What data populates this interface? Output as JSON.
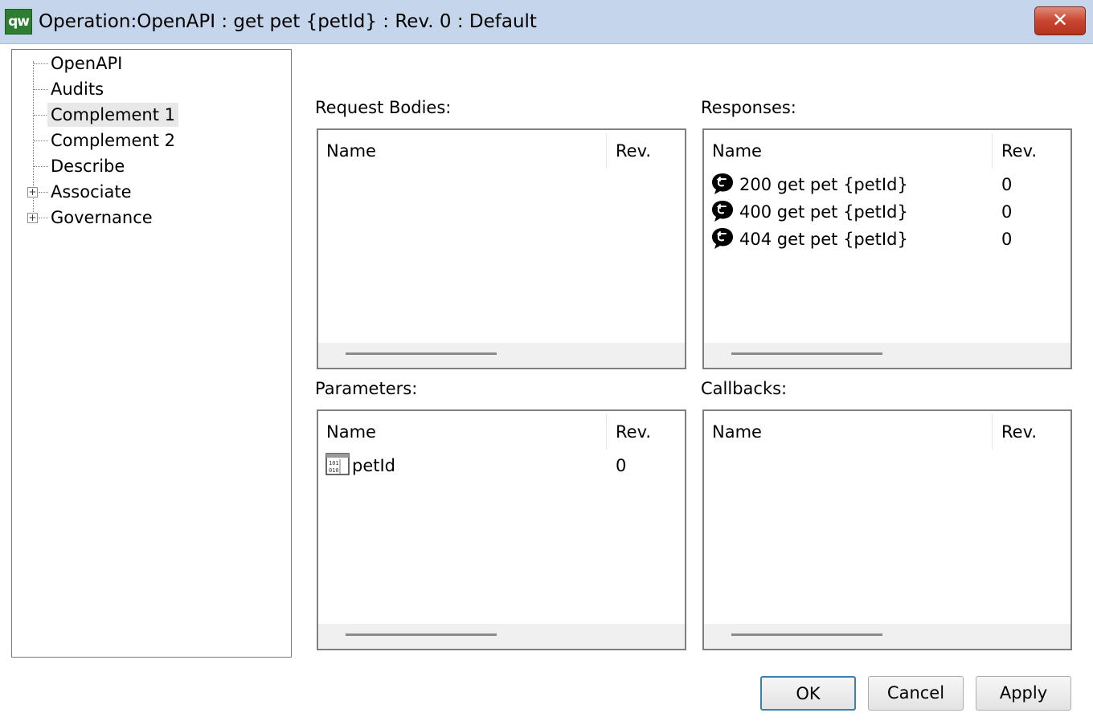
{
  "window": {
    "app_icon_text": "qw",
    "title": "Operation:OpenAPI : get pet {petId} : Rev. 0  : Default",
    "close_glyph": "✕"
  },
  "tree": {
    "items": [
      {
        "label": "OpenAPI",
        "expandable": false,
        "selected": false
      },
      {
        "label": "Audits",
        "expandable": false,
        "selected": false
      },
      {
        "label": "Complement 1",
        "expandable": false,
        "selected": true
      },
      {
        "label": "Complement 2",
        "expandable": false,
        "selected": false
      },
      {
        "label": "Describe",
        "expandable": false,
        "selected": false
      },
      {
        "label": "Associate",
        "expandable": true,
        "selected": false
      },
      {
        "label": "Governance",
        "expandable": true,
        "selected": false
      }
    ],
    "expander_glyph": "+"
  },
  "request_bodies": {
    "label": "Request Bodies:",
    "col_name": "Name",
    "col_rev": "Rev.",
    "rows": []
  },
  "responses": {
    "label": "Responses:",
    "col_name": "Name",
    "col_rev": "Rev.",
    "row_icon": "response-speech-icon",
    "rows": [
      {
        "name": "200 get pet {petId}",
        "rev": "0"
      },
      {
        "name": "400 get pet {petId}",
        "rev": "0"
      },
      {
        "name": "404 get pet {petId}",
        "rev": "0"
      }
    ]
  },
  "parameters": {
    "label": "Parameters:",
    "col_name": "Name",
    "col_rev": "Rev.",
    "row_icon": "binary-parameter-icon",
    "rows": [
      {
        "name": "petId",
        "rev": "0"
      }
    ]
  },
  "callbacks": {
    "label": "Callbacks:",
    "col_name": "Name",
    "col_rev": "Rev.",
    "rows": []
  },
  "buttons": {
    "ok": "OK",
    "cancel": "Cancel",
    "apply": "Apply"
  }
}
